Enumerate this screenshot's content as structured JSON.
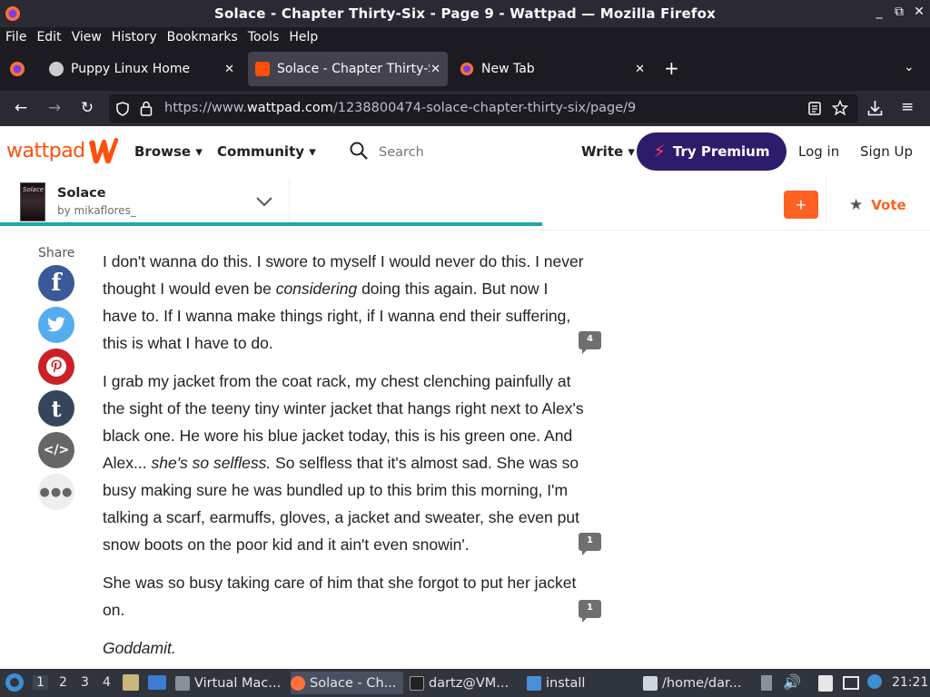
{
  "window": {
    "title": "Solace - Chapter Thirty-Six - Page 9 - Wattpad — Mozilla Firefox",
    "minimize": "_",
    "restore": "⧉",
    "close": "✕"
  },
  "menu": [
    "File",
    "Edit",
    "View",
    "History",
    "Bookmarks",
    "Tools",
    "Help"
  ],
  "tabs": [
    {
      "label": "Puppy Linux Home",
      "close": "✕"
    },
    {
      "label": "Solace - Chapter Thirty-S",
      "close": "✕"
    },
    {
      "label": "New Tab",
      "close": "✕"
    }
  ],
  "new_tab": "+",
  "url": {
    "prefix": "https://www.",
    "domain": "wattpad.com",
    "path": "/1238800474-solace-chapter-thirty-six/page/9"
  },
  "header": {
    "logo_text": "wattpad",
    "browse": "Browse",
    "community": "Community",
    "search_placeholder": "Search",
    "write": "Write",
    "premium": "Try Premium",
    "login": "Log in",
    "signup": "Sign Up"
  },
  "story": {
    "cover_text": "Solace",
    "title": "Solace",
    "author": "by mikaflores_",
    "progress": 0.583,
    "add_label": "+",
    "vote_label": "Vote"
  },
  "share": {
    "label": "Share",
    "buttons": [
      {
        "name": "facebook-icon",
        "glyph": "f",
        "color": "#3b5998"
      },
      {
        "name": "twitter-icon",
        "glyph": "🐦",
        "color": "#55acee"
      },
      {
        "name": "pinterest-icon",
        "glyph": "P",
        "color": "#cb2027"
      },
      {
        "name": "tumblr-icon",
        "glyph": "t",
        "color": "#35465c"
      },
      {
        "name": "embed-icon",
        "glyph": "</>",
        "color": "#666666"
      },
      {
        "name": "more-icon",
        "glyph": "•••",
        "color": "#eeeeee"
      }
    ]
  },
  "body": {
    "p1_a": "I don't wanna do this. I swore to myself I would never do this. I never thought I would even be ",
    "p1_em": "considering",
    "p1_b": " doing this again. But now I have to. If I wanna make things right, if I wanna end their suffering, this is what I have to do.",
    "p1_comments": "4",
    "p2_a": "I grab my jacket from the coat rack, my chest clenching painfully at the sight of the teeny tiny winter jacket that hangs right next to Alex's black one. He wore his blue jacket today, this is his green one. And Alex... ",
    "p2_em": "she's so selfless.",
    "p2_b": " So selfless that it's almost sad. She was so busy making sure he was bundled up to this brim this morning, I'm talking a scarf, earmuffs, gloves, a jacket and sweater, she even put snow boots on the poor kid and it ain't even snowin'.",
    "p2_comments": "1",
    "p3": "She was so busy taking care of him that she forgot to put her jacket on.",
    "p3_comments": "1",
    "p4": "Goddamit."
  },
  "taskbar": {
    "workspaces": [
      "1",
      "2",
      "3",
      "4"
    ],
    "items": [
      {
        "label": "Virtual Mac..."
      },
      {
        "label": "Solace - Ch..."
      },
      {
        "label": "dartz@VM..."
      },
      {
        "label": "install"
      },
      {
        "label": "/home/dar..."
      }
    ],
    "clock": "21:21"
  },
  "colors": {
    "wattpad_orange": "#ff500a",
    "premium_bg": "#2d1c6b",
    "progress": "#1ea6a9"
  }
}
